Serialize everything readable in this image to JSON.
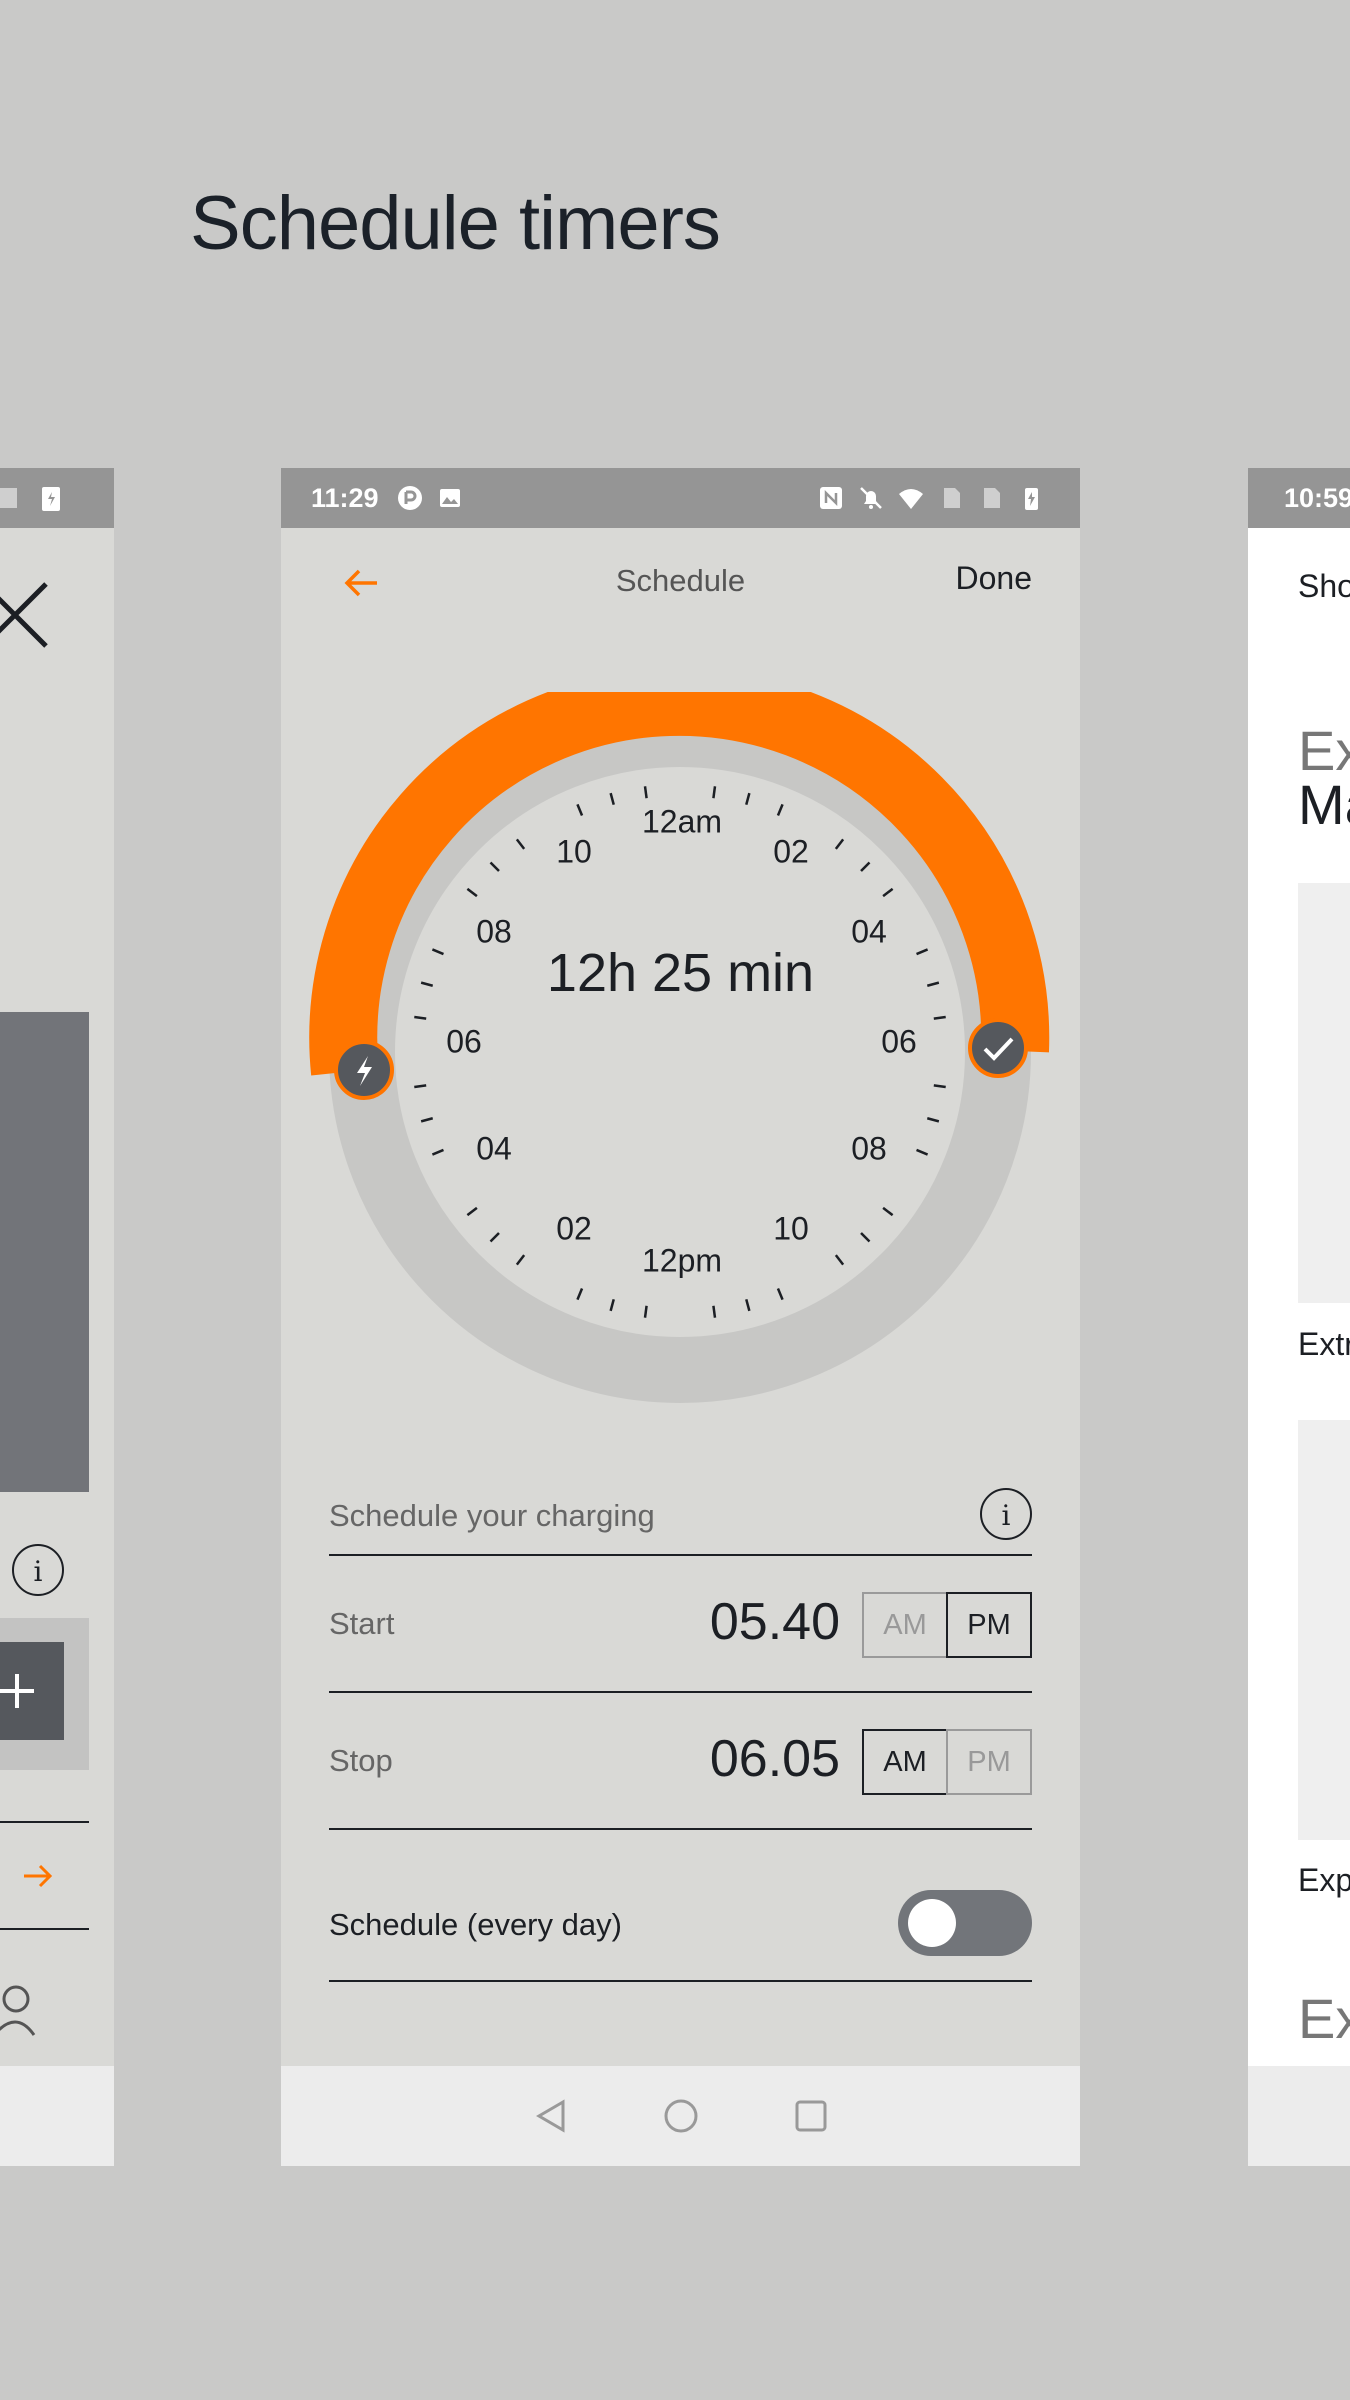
{
  "page_title": "Schedule timers",
  "main_screen": {
    "status": {
      "time": "11:29"
    },
    "header": {
      "title": "Schedule",
      "done_label": "Done"
    },
    "dial": {
      "duration": "12h 25 min",
      "labels": {
        "n12am": "12am",
        "n02r": "02",
        "n04r": "04",
        "n06r": "06",
        "n08r": "08",
        "n10r": "10",
        "n12pm": "12pm",
        "n10l": "10",
        "n08l": "08",
        "n06l": "06",
        "n04l": "04",
        "n02l": "02"
      },
      "start_handle_icon": "lightning-icon",
      "end_handle_icon": "check-icon",
      "arc_color": "#ff7500",
      "track_color": "#c7c7c5"
    },
    "schedule_label": "Schedule your charging",
    "start": {
      "label": "Start",
      "value": "05.40",
      "am": "AM",
      "pm": "PM",
      "selected": "PM"
    },
    "stop": {
      "label": "Stop",
      "value": "06.05",
      "am": "AM",
      "pm": "PM",
      "selected": "AM"
    },
    "repeat": {
      "label": "Schedule (every day)",
      "enabled": false
    },
    "accent_color": "#ff7500"
  },
  "right_screen": {
    "status_time": "10:59",
    "line1": "Sho",
    "heading1_a": "Ex",
    "heading1_b": "Ma",
    "caption1": "Extr",
    "caption2": "Exp",
    "heading2": "Ex"
  }
}
